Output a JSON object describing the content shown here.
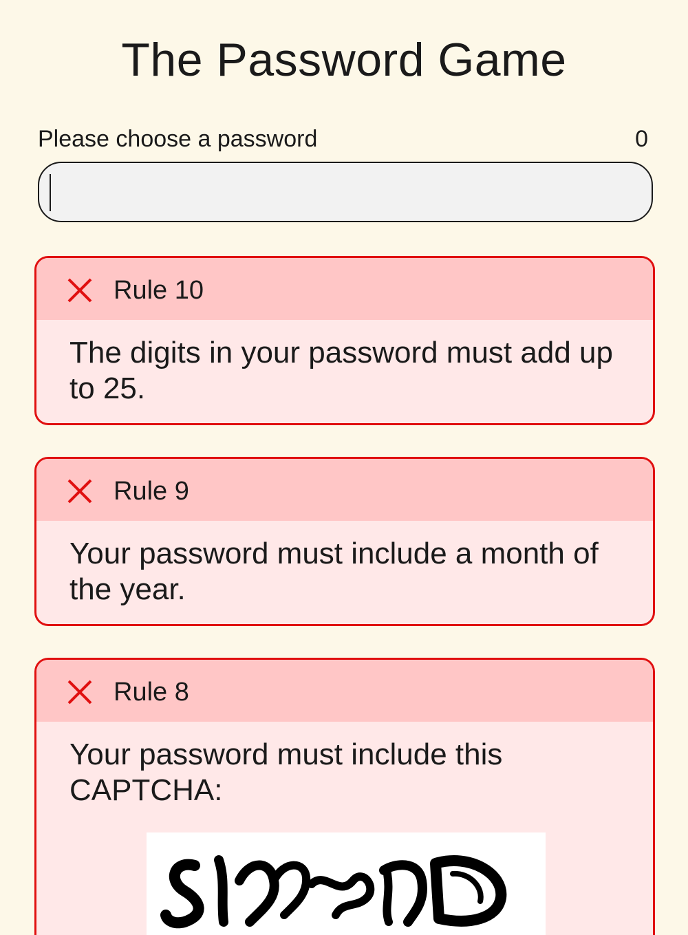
{
  "game": {
    "title": "The Password Game"
  },
  "password": {
    "label": "Please choose a password",
    "value": "",
    "char_count": "0"
  },
  "rules": [
    {
      "title": "Rule 10",
      "text": "The digits in your password must add up to 25.",
      "status": "failed",
      "status_icon": "x-icon"
    },
    {
      "title": "Rule 9",
      "text": "Your password must include a month of the year.",
      "status": "failed",
      "status_icon": "x-icon"
    },
    {
      "title": "Rule 8",
      "text": "Your password must include this CAPTCHA:",
      "status": "failed",
      "status_icon": "x-icon"
    }
  ],
  "colors": {
    "page_background": "#fdf8e8",
    "rule_border": "#e01010",
    "rule_header": "#ffc6c6",
    "rule_body": "#ffe8e8",
    "input_background": "#f2f2f2"
  }
}
